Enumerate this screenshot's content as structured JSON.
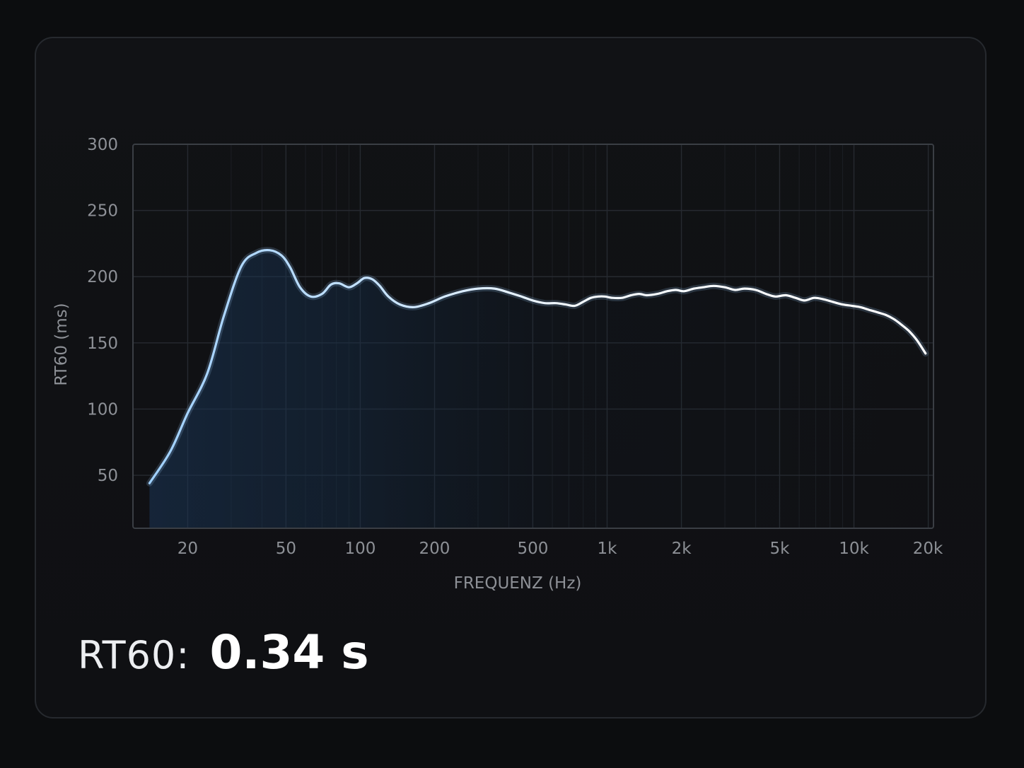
{
  "chart_data": {
    "type": "line",
    "title": "",
    "xlabel": "FREQUENZ (Hz)",
    "ylabel": "RT60 (ms)",
    "xscale": "log",
    "xlim": [
      12,
      21000
    ],
    "ylim": [
      10,
      300
    ],
    "x_ticks": [
      20,
      50,
      100,
      200,
      500,
      1000,
      2000,
      5000,
      10000,
      20000
    ],
    "x_tick_labels": [
      "20",
      "50",
      "100",
      "200",
      "500",
      "1k",
      "2k",
      "5k",
      "10k",
      "20k"
    ],
    "y_ticks": [
      50,
      100,
      150,
      200,
      250,
      300
    ],
    "y_tick_labels": [
      "50",
      "100",
      "150",
      "200",
      "250",
      "300"
    ],
    "grid": true,
    "colors": {
      "line_low": "#9fd0ff",
      "line_high": "#ffffff",
      "fill": "#1a3556",
      "grid": "#262a30",
      "frame": "#3a3e44"
    },
    "series": [
      {
        "x": [
          14,
          17,
          20,
          24,
          28,
          33,
          38,
          43,
          48,
          52,
          57,
          63,
          70,
          76,
          82,
          90,
          97,
          104,
          112,
          120,
          130,
          145,
          165,
          190,
          220,
          260,
          300,
          350,
          400,
          450,
          500,
          560,
          620,
          680,
          740,
          800,
          860,
          920,
          980,
          1050,
          1150,
          1250,
          1350,
          1450,
          1600,
          1750,
          1900,
          2050,
          2250,
          2450,
          2700,
          3000,
          3300,
          3600,
          4000,
          4400,
          4800,
          5300,
          5800,
          6300,
          6900,
          7500,
          8200,
          9000,
          9800,
          10600,
          11500,
          12500,
          13500,
          14500,
          15500,
          16700,
          18000,
          19500
        ],
        "y": [
          44,
          68,
          97,
          127,
          170,
          208,
          218,
          220,
          216,
          207,
          192,
          185,
          187,
          194,
          195,
          192,
          195,
          199,
          198,
          193,
          185,
          179,
          177,
          180,
          185,
          189,
          191,
          191,
          188,
          185,
          182,
          180,
          180,
          179,
          178,
          181,
          184,
          185,
          185,
          184,
          184,
          186,
          187,
          186,
          187,
          189,
          190,
          189,
          191,
          192,
          193,
          192,
          190,
          191,
          190,
          187,
          185,
          186,
          184,
          182,
          184,
          183,
          181,
          179,
          178,
          177,
          175,
          173,
          171,
          168,
          164,
          159,
          152,
          142
        ]
      }
    ]
  },
  "readout": {
    "label": "RT60:",
    "value": "0.34 s"
  }
}
